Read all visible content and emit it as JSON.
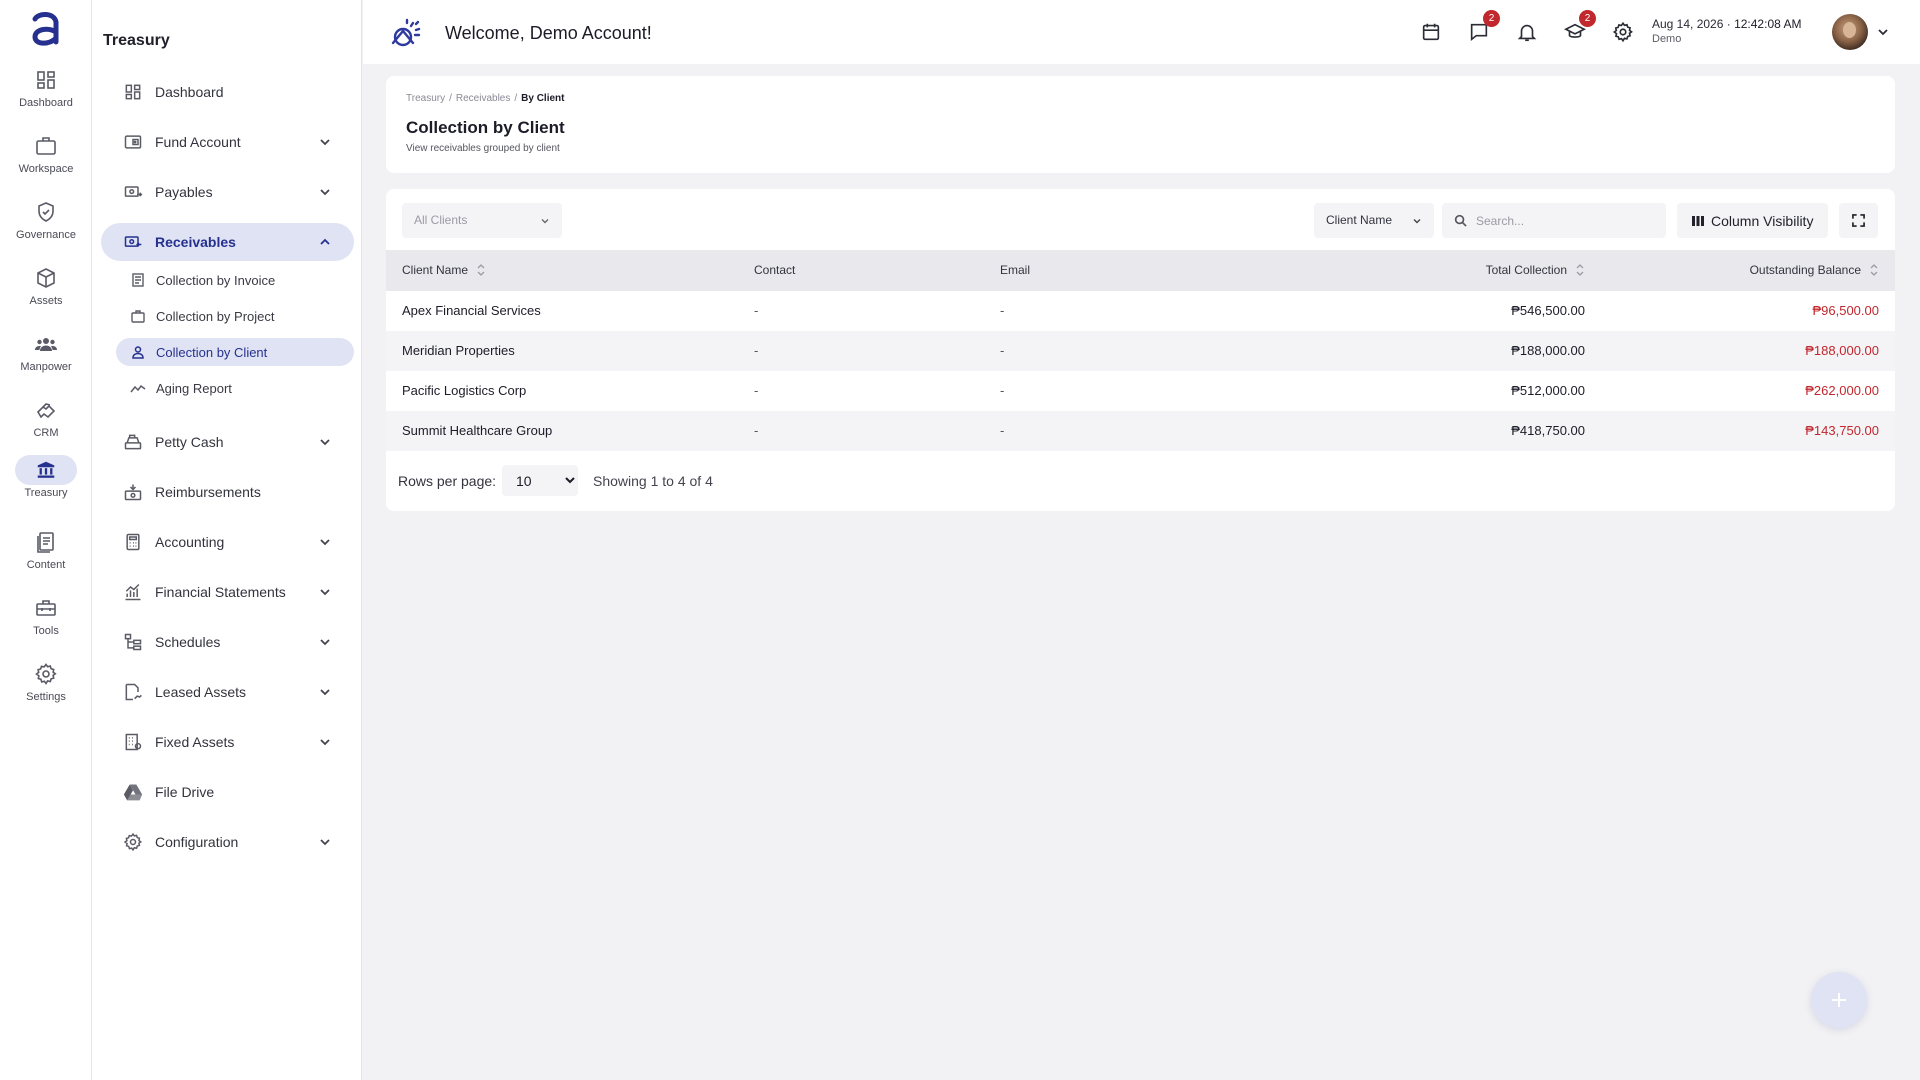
{
  "rail": {
    "items": [
      {
        "label": "Dashboard",
        "icon": "dashboard-icon"
      },
      {
        "label": "Workspace",
        "icon": "briefcase-icon"
      },
      {
        "label": "Governance",
        "icon": "shield-check-icon"
      },
      {
        "label": "Assets",
        "icon": "box-icon"
      },
      {
        "label": "Manpower",
        "icon": "people-icon"
      },
      {
        "label": "CRM",
        "icon": "handshake-icon"
      },
      {
        "label": "Treasury",
        "icon": "bank-icon",
        "active": true
      },
      {
        "label": "Content",
        "icon": "document-icon"
      },
      {
        "label": "Tools",
        "icon": "toolbox-icon"
      },
      {
        "label": "Settings",
        "icon": "gear-icon"
      }
    ]
  },
  "sidebar": {
    "title": "Treasury",
    "items": [
      {
        "label": "Dashboard",
        "icon": "dashboard-icon"
      },
      {
        "label": "Fund Account",
        "icon": "wallet-icon",
        "expandable": true
      },
      {
        "label": "Payables",
        "icon": "money-out-icon",
        "expandable": true
      },
      {
        "label": "Receivables",
        "icon": "money-in-icon",
        "expandable": true,
        "open": true
      },
      {
        "label": "Petty Cash",
        "icon": "cash-register-icon",
        "expandable": true
      },
      {
        "label": "Reimbursements",
        "icon": "reimburse-icon"
      },
      {
        "label": "Accounting",
        "icon": "calculator-icon",
        "expandable": true
      },
      {
        "label": "Financial Statements",
        "icon": "chart-icon",
        "expandable": true
      },
      {
        "label": "Schedules",
        "icon": "schedule-tree-icon",
        "expandable": true
      },
      {
        "label": "Leased Assets",
        "icon": "lease-icon",
        "expandable": true
      },
      {
        "label": "Fixed Assets",
        "icon": "building-icon",
        "expandable": true
      },
      {
        "label": "File Drive",
        "icon": "drive-icon"
      },
      {
        "label": "Configuration",
        "icon": "gear-icon",
        "expandable": true
      }
    ],
    "receivables_sub": [
      {
        "label": "Collection by Invoice",
        "icon": "invoice-icon"
      },
      {
        "label": "Collection by Project",
        "icon": "briefcase-icon"
      },
      {
        "label": "Collection by Client",
        "icon": "person-icon",
        "active": true
      },
      {
        "label": "Aging Report",
        "icon": "trend-icon"
      }
    ]
  },
  "topbar": {
    "welcome": "Welcome, Demo Account!",
    "messages_badge": "2",
    "courses_badge": "2",
    "date": "Aug 14, 2026",
    "time": "12:42:08 AM",
    "user": "Demo"
  },
  "header": {
    "breadcrumb": [
      "Treasury",
      "Receivables",
      "By Client"
    ],
    "title": "Collection by Client",
    "subtitle": "View receivables grouped by client"
  },
  "toolbar": {
    "client_filter": "All Clients",
    "search_column": "Client Name",
    "search_placeholder": "Search...",
    "column_visibility": "Column Visibility"
  },
  "table": {
    "columns": [
      "Client Name",
      "Contact",
      "Email",
      "Total Collection",
      "Outstanding Balance"
    ],
    "rows": [
      {
        "name": "Apex Financial Services",
        "contact": "-",
        "email": "-",
        "total": "₱546,500.00",
        "outstanding": "₱96,500.00"
      },
      {
        "name": "Meridian Properties",
        "contact": "-",
        "email": "-",
        "total": "₱188,000.00",
        "outstanding": "₱188,000.00"
      },
      {
        "name": "Pacific Logistics Corp",
        "contact": "-",
        "email": "-",
        "total": "₱512,000.00",
        "outstanding": "₱262,000.00"
      },
      {
        "name": "Summit Healthcare Group",
        "contact": "-",
        "email": "-",
        "total": "₱418,750.00",
        "outstanding": "₱143,750.00"
      }
    ]
  },
  "pagination": {
    "rows_label": "Rows per page:",
    "rows_value": "10",
    "info": "Showing 1 to 4 of 4"
  },
  "colors": {
    "accent": "#26318f",
    "active_bg": "#dfe3f3",
    "negative": "#c1272d"
  }
}
